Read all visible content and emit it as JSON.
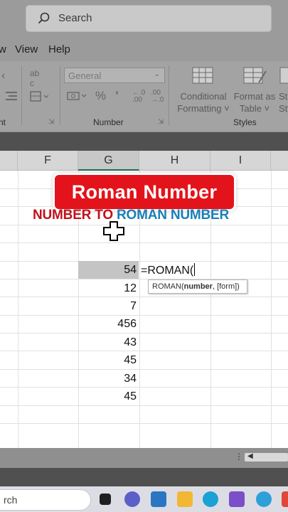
{
  "titlebar": {
    "search_label": "Search"
  },
  "menubar": {
    "items": [
      "w",
      "View",
      "Help"
    ]
  },
  "ribbon": {
    "number_format": "General",
    "percent_symbol": "%",
    "comma_symbol": "̓",
    "number_group_label": "Number",
    "left_group_label": "nt",
    "conditional_formatting": [
      "Conditional",
      "Formatting ˅"
    ],
    "format_as_table": [
      "Format as",
      "Table ˅"
    ],
    "cell_styles_partial": [
      "St",
      "Sty"
    ],
    "styles_group_label": "Styles"
  },
  "columns": [
    "F",
    "G",
    "H",
    "I"
  ],
  "banner": {
    "title": "Roman Number"
  },
  "subtitle": {
    "part1": "NUMBER TO ",
    "part2": "ROMAN NUMBER"
  },
  "cells": {
    "g_values": [
      "54",
      "12",
      "7",
      "456",
      "43",
      "45",
      "34",
      "45"
    ],
    "formula": "=ROMAN(",
    "tooltip_fn": "ROMAN(",
    "tooltip_arg": "number",
    "tooltip_rest": ", [form])"
  },
  "taskbar": {
    "search_partial": "rch"
  },
  "colors": {
    "banner_red": "#e3131b",
    "subtitle_red": "#c0121b",
    "subtitle_blue": "#1a7fb8",
    "excel_green": "#1e7145"
  }
}
